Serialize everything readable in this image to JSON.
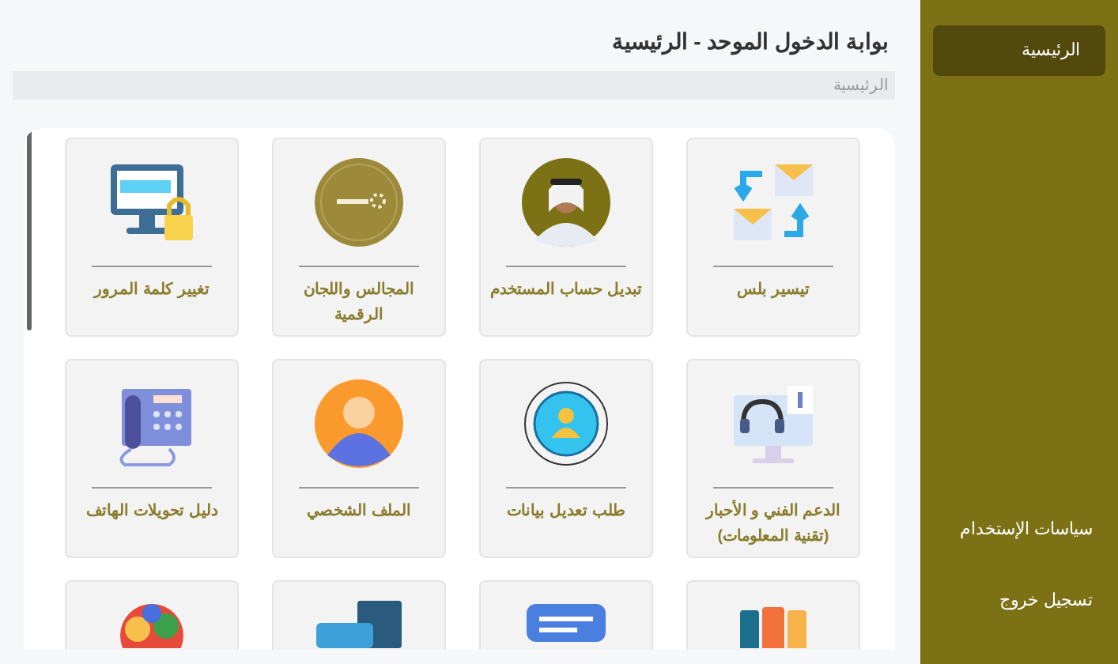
{
  "sidebar": {
    "items": [
      {
        "label": "الرئيسية",
        "selected": true
      }
    ],
    "footer_items": [
      {
        "label": "سياسات الإستخدام"
      },
      {
        "label": "تسجيل خروج"
      }
    ]
  },
  "header": {
    "title": "بوابة الدخول الموحد - الرئيسية",
    "breadcrumb": "الرئيسية"
  },
  "tiles": [
    {
      "kind": "labeled",
      "label": "تيسير بلس"
    },
    {
      "kind": "labeled",
      "label": "تبديل حساب المستخدم"
    },
    {
      "kind": "labeled",
      "label": "المجالس واللجان الرقمية"
    },
    {
      "kind": "labeled",
      "label": "تغيير كلمة المرور"
    },
    {
      "kind": "labeled",
      "label": "الدعم الفني و الأحبار (تقنية المعلومات)"
    },
    {
      "kind": "labeled",
      "label": "طلب تعديل بيانات"
    },
    {
      "kind": "labeled",
      "label": "الملف الشخصي"
    },
    {
      "kind": "labeled",
      "label": "دليل تحويلات الهاتف"
    },
    {
      "kind": "partial"
    },
    {
      "kind": "partial"
    },
    {
      "kind": "partial"
    },
    {
      "kind": "partial"
    }
  ]
}
